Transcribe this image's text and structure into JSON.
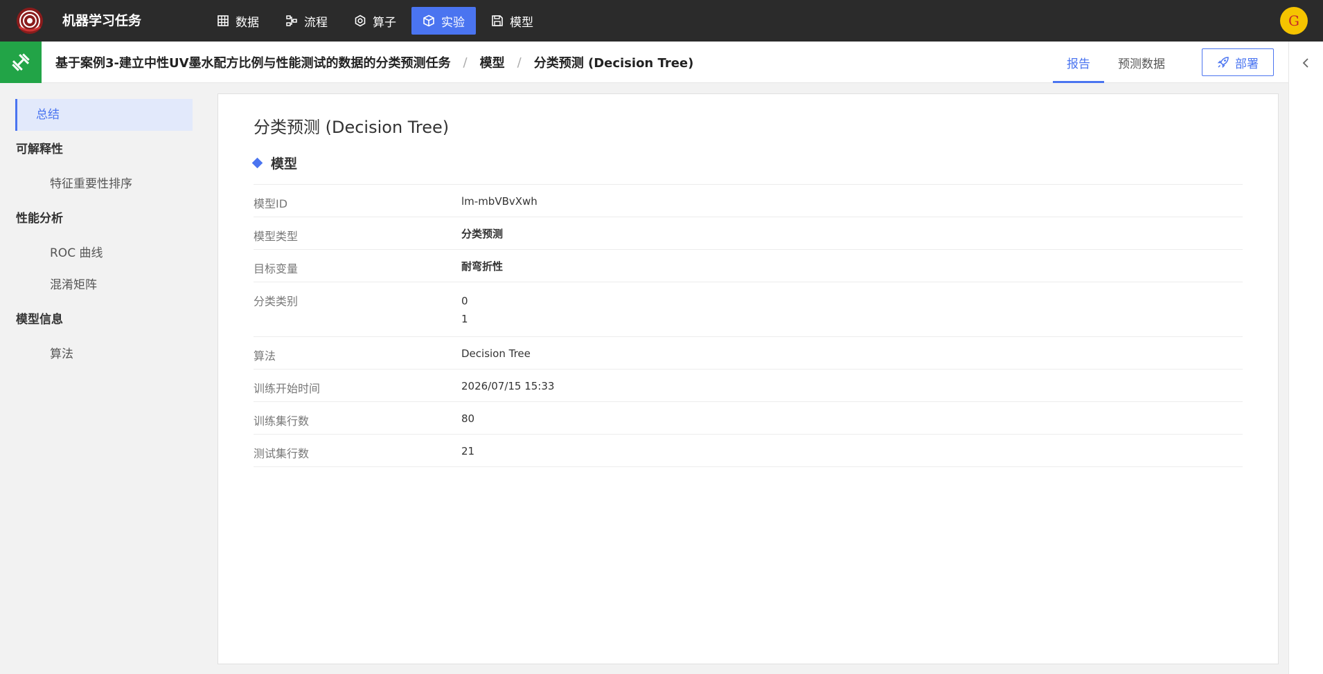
{
  "app": {
    "title": "机器学习任务"
  },
  "nav": [
    {
      "label": "数据",
      "icon": "table-icon"
    },
    {
      "label": "流程",
      "icon": "flow-icon"
    },
    {
      "label": "算子",
      "icon": "hexagon-gear-icon"
    },
    {
      "label": "实验",
      "icon": "cube-icon",
      "active": true
    },
    {
      "label": "模型",
      "icon": "save-icon"
    }
  ],
  "user": {
    "avatar_letter": "G"
  },
  "breadcrumb": {
    "task": "基于案例3-建立中性UV墨水配方比例与性能测试的数据的分类预测任务",
    "sep": "/",
    "model": "模型",
    "current": "分类预测 (Decision Tree)"
  },
  "tabs": {
    "report": "报告",
    "prediction": "预测数据"
  },
  "deploy": {
    "label": "部署"
  },
  "sidebar": {
    "summary": "总结",
    "groups": [
      {
        "title": "可解释性",
        "items": [
          "特征重要性排序"
        ]
      },
      {
        "title": "性能分析",
        "items": [
          "ROC 曲线",
          "混淆矩阵"
        ]
      },
      {
        "title": "模型信息",
        "items": [
          "算法"
        ]
      }
    ]
  },
  "main": {
    "title": "分类预测 (Decision Tree)",
    "section": "模型",
    "rows": {
      "model_id": {
        "label": "模型ID",
        "value": "lm-mbVBvXwh"
      },
      "model_type": {
        "label": "模型类型",
        "value": "分类预测"
      },
      "target": {
        "label": "目标变量",
        "value": "耐弯折性"
      },
      "classes": {
        "label": "分类类别",
        "values": [
          "0",
          "1"
        ]
      },
      "algorithm": {
        "label": "算法",
        "value": "Decision Tree"
      },
      "train_start": {
        "label": "训练开始时间",
        "value": "2026/07/15 15:33"
      },
      "train_rows": {
        "label": "训练集行数",
        "value": "80"
      },
      "test_rows": {
        "label": "测试集行数",
        "value": "21"
      }
    }
  },
  "colors": {
    "accent": "#4a74f0",
    "topbar": "#2b2b2b",
    "header_icon": "#22a447",
    "avatar": "#f5c400"
  }
}
